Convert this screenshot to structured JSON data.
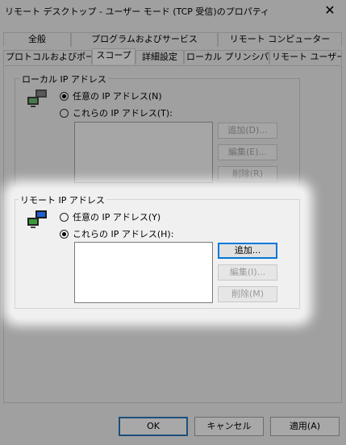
{
  "window": {
    "title": "リモート デスクトップ - ユーザー モード (TCP 受信)のプロパティ",
    "close_glyph": "✕"
  },
  "tabs": {
    "row1": [
      "全般",
      "プログラムおよびサービス",
      "リモート コンピューター"
    ],
    "row2": [
      "プロトコルおよびポート",
      "スコープ",
      "詳細設定",
      "ローカル プリンシパル",
      "リモート ユーザー"
    ],
    "active": "スコープ"
  },
  "local": {
    "legend": "ローカル IP アドレス",
    "radio_any": "任意の IP アドレス(N)",
    "radio_these": "これらの IP アドレス(T):",
    "selected": "any",
    "add_label": "追加(D)...",
    "edit_label": "編集(E)...",
    "remove_label": "削除(R)",
    "icon": "network-computers-icon"
  },
  "remote": {
    "legend": "リモート IP アドレス",
    "radio_any": "任意の IP アドレス(Y)",
    "radio_these": "これらの IP アドレス(H):",
    "selected": "these",
    "add_label": "追加...",
    "edit_label": "編集(I)...",
    "remove_label": "削除(M)",
    "icon": "network-computers-icon"
  },
  "footer": {
    "ok_label": "OK",
    "cancel_label": "キャンセル",
    "apply_label": "適用(A)"
  },
  "colors": {
    "overlay": "#a0a0a0",
    "highlight": "#f0f0f0",
    "accent": "#0078d7"
  }
}
